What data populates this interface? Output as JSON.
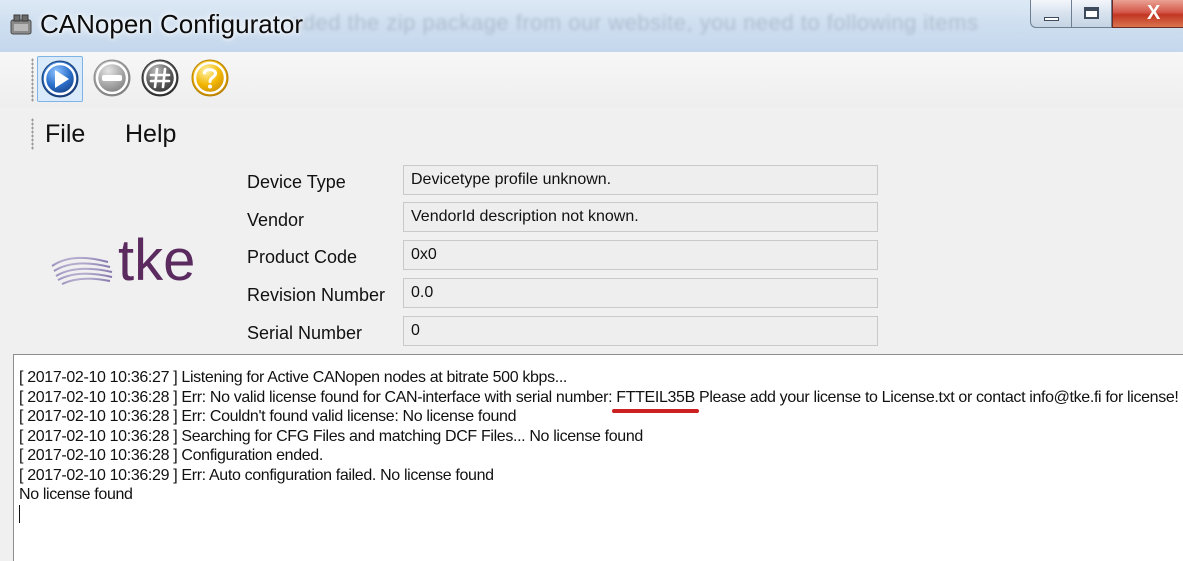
{
  "window": {
    "title": "CANopen Configurator",
    "background_text": "aded the zip package from our website, you need to following items",
    "close_glyph": "X",
    "icon": "app-icon"
  },
  "toolbar": {
    "buttons": [
      {
        "name": "run",
        "icon": "play-icon",
        "color": "#2a6fcb",
        "state": "pressed"
      },
      {
        "name": "stop",
        "icon": "stop-icon",
        "color": "#9a9a9a",
        "state": "disabled"
      },
      {
        "name": "configure",
        "icon": "hash-icon",
        "color": "#555555"
      },
      {
        "name": "help",
        "icon": "question-icon",
        "color": "#f2b705"
      }
    ]
  },
  "menu": {
    "items": [
      {
        "label": "File"
      },
      {
        "label": "Help"
      }
    ]
  },
  "logo": {
    "text": "tke",
    "color": "#5b2a5e"
  },
  "device_info": {
    "fields": [
      {
        "label": "Device Type",
        "value": "Devicetype profile unknown."
      },
      {
        "label": "Vendor",
        "value": "VendorId description not known."
      },
      {
        "label": "Product Code",
        "value": "0x0"
      },
      {
        "label": "Revision Number",
        "value": "0.0"
      },
      {
        "label": "Serial Number",
        "value": "0"
      }
    ]
  },
  "log": {
    "lines": [
      "[ 2017-02-10 10:36:27 ] Listening for Active CANopen nodes at bitrate 500 kbps...",
      {
        "before": "[ 2017-02-10 10:36:28 ] Err: No valid license found for CAN-interface with serial number: ",
        "serial": "FTTEIL35B",
        "after": " Please add your license to License.txt or contact info@tke.fi for license!"
      },
      "[ 2017-02-10 10:36:28 ] Err: Couldn't found valid license: No license found",
      "[ 2017-02-10 10:36:28 ] Searching for CFG Files and matching DCF Files... No license found",
      "[ 2017-02-10 10:36:28 ] Configuration ended.",
      "[ 2017-02-10 10:36:29 ] Err: Auto configuration failed. No license found",
      "No license found"
    ],
    "highlight_color": "#cc1f1f"
  }
}
